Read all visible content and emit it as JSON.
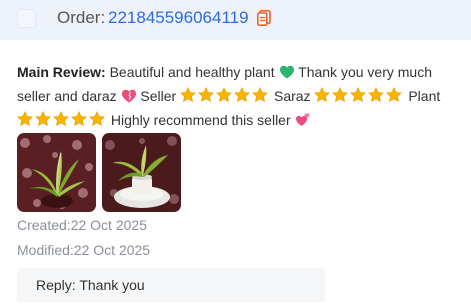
{
  "order": {
    "label": "Order:",
    "number": "221845596064119"
  },
  "review": {
    "label": "Main Review:",
    "text_1": "Beautiful and healthy plant",
    "text_2": "Thank you very much seller and daraz",
    "text_3": "Seller",
    "text_4": "Saraz",
    "text_5": "Plant",
    "text_6": "Highly recommend this seller",
    "emoji_1": "green-heart-icon",
    "emoji_2": "pink-heart-icon",
    "emoji_3": "two-hearts-icon",
    "stars_per_group": 5
  },
  "photos": [
    "plant-photo-1",
    "plant-photo-2"
  ],
  "meta": {
    "created": "Created:22 Oct 2025",
    "modified": "Modified:22 Oct 2025"
  },
  "reply": {
    "text": "Reply: Thank you"
  },
  "colors": {
    "header_bg": "#eef2fb",
    "order_link": "#2f6ad9",
    "copy_icon": "#e8642c",
    "star": "#f7b500"
  }
}
